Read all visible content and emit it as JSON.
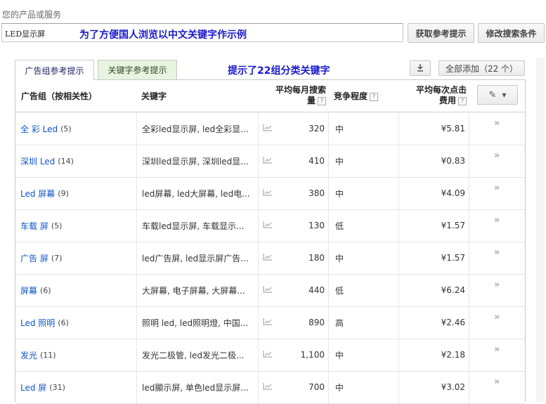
{
  "header": {
    "field_label": "您的产品或服务",
    "search_value": "LED显示屏",
    "annotation_top": "为了方便国人浏览以中文关键字作示例",
    "get_ideas_button": "获取参考提示",
    "modify_search_button": "修改搜索条件"
  },
  "tabs": {
    "ad_group_ideas": "广告组参考提示",
    "keyword_ideas": "关键字参考提示",
    "annotation_tabs": "提示了22组分类关键字",
    "download_icon": "download-icon",
    "add_all_button": "全部添加（22 个）"
  },
  "columns": {
    "ad_group": "广告组（按相关性）",
    "keywords": "关键字",
    "avg_monthly_searches": "平均每月搜索量",
    "competition": "竞争程度",
    "avg_cpc": "平均每次点击费用",
    "edit_icon": "pencil-icon"
  },
  "rows": [
    {
      "group": "全 彩 Led",
      "count": "(5)",
      "keywords": "全彩led显示屏, led全彩显...",
      "volume": "320",
      "competition": "中",
      "cpc": "¥5.81"
    },
    {
      "group": "深圳 Led",
      "count": "(14)",
      "keywords": "深圳led显示屏, 深圳led显...",
      "volume": "410",
      "competition": "中",
      "cpc": "¥0.83"
    },
    {
      "group": "Led 屏幕",
      "count": "(9)",
      "keywords": "led屏幕, led大屏幕, led电...",
      "volume": "380",
      "competition": "中",
      "cpc": "¥4.09"
    },
    {
      "group": "车载 屏",
      "count": "(5)",
      "keywords": "车载led显示屏, 车载显示...",
      "volume": "130",
      "competition": "低",
      "cpc": "¥1.57"
    },
    {
      "group": "广告 屏",
      "count": "(7)",
      "keywords": "led广告屏, led显示屏广告...",
      "volume": "180",
      "competition": "中",
      "cpc": "¥1.57"
    },
    {
      "group": "屏幕",
      "count": "(6)",
      "keywords": "大屏幕, 电子屏幕, 大屏幕...",
      "volume": "440",
      "competition": "低",
      "cpc": "¥6.24"
    },
    {
      "group": "Led 照明",
      "count": "(6)",
      "keywords": "照明 led, led照明燈, 中国...",
      "volume": "890",
      "competition": "高",
      "cpc": "¥2.46"
    },
    {
      "group": "发光",
      "count": "(11)",
      "keywords": "发光二极管, led发光二极...",
      "volume": "1,100",
      "competition": "中",
      "cpc": "¥2.18"
    },
    {
      "group": "Led 屏",
      "count": "(31)",
      "keywords": "led顯示屏, 单色led显示屏...",
      "volume": "700",
      "competition": "中",
      "cpc": "¥3.02"
    }
  ]
}
